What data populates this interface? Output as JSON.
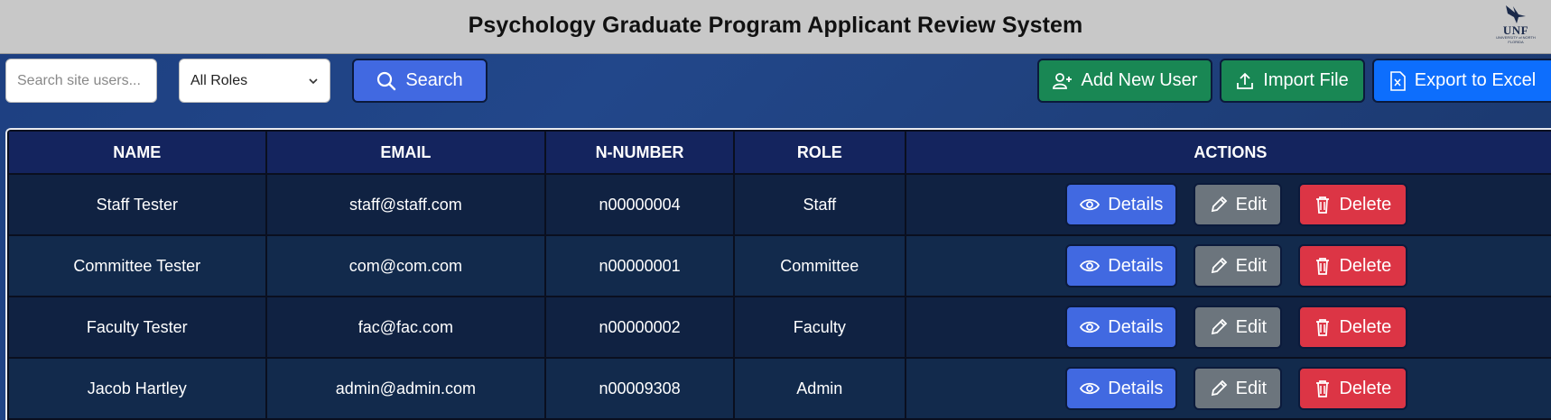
{
  "app": {
    "title": "Psychology Graduate Program Applicant Review System",
    "logo_text": "UNF",
    "logo_subtext": "UNIVERSITY of NORTH FLORIDA"
  },
  "toolbar": {
    "search_placeholder": "Search site users...",
    "search_value": "",
    "role_filter_selected": "All Roles",
    "search_label": "Search",
    "add_user_label": "Add New User",
    "import_label": "Import File",
    "export_label": "Export to Excel"
  },
  "table": {
    "columns": [
      "NAME",
      "EMAIL",
      "N-NUMBER",
      "ROLE",
      "ACTIONS"
    ],
    "rows": [
      {
        "name": "Staff Tester",
        "email": "staff@staff.com",
        "nnumber": "n00000004",
        "role": "Staff"
      },
      {
        "name": "Committee Tester",
        "email": "com@com.com",
        "nnumber": "n00000001",
        "role": "Committee"
      },
      {
        "name": "Faculty Tester",
        "email": "fac@fac.com",
        "nnumber": "n00000002",
        "role": "Faculty"
      },
      {
        "name": "Jacob Hartley",
        "email": "admin@admin.com",
        "nnumber": "n00009308",
        "role": "Admin"
      }
    ],
    "action_labels": {
      "details": "Details",
      "edit": "Edit",
      "delete": "Delete"
    }
  },
  "icons": {
    "search": "search-icon",
    "add_user": "person-plus-icon",
    "import": "upload-icon",
    "export": "excel-file-icon",
    "details": "eye-icon",
    "edit": "pencil-icon",
    "delete": "trash-icon",
    "dropdown": "chevron-down-icon"
  },
  "colors": {
    "header_bg": "#c8c8c8",
    "page_bg": "#1f4285",
    "primary_blue": "#4169e1",
    "success_green": "#198754",
    "export_blue": "#0d6efd",
    "edit_gray": "#6c757d",
    "delete_red": "#dc3545",
    "table_header_bg": "#14245e",
    "table_row_bg": "#102242"
  }
}
